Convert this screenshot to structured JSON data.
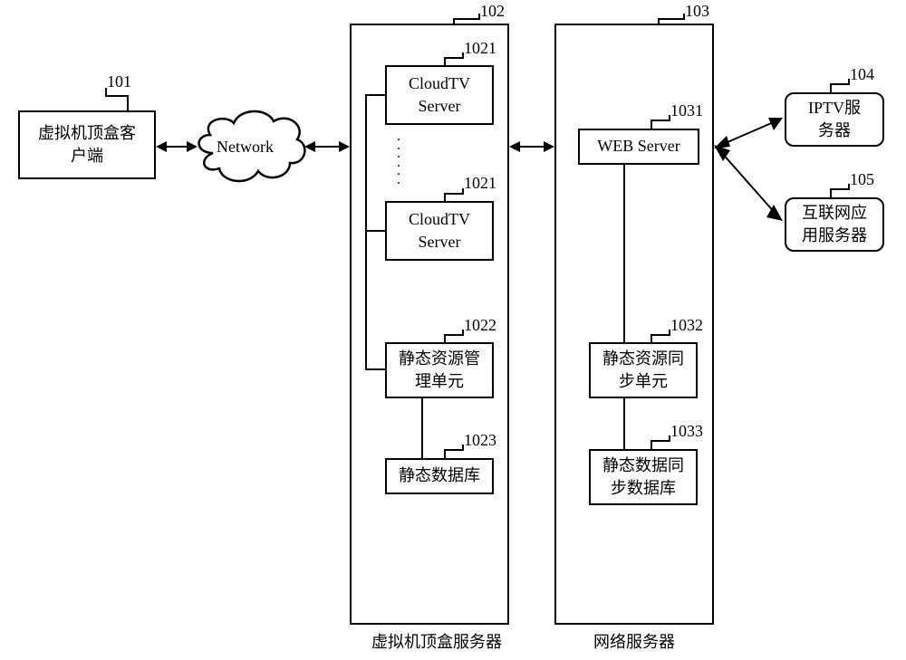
{
  "client": {
    "label": "虚拟机顶盒客\n户端",
    "id": "101"
  },
  "network": {
    "label": "Network"
  },
  "vstb_server": {
    "id": "102",
    "caption": "虚拟机顶盒服务器",
    "cloudtv": {
      "label": "CloudTV\nServer",
      "id": "1021"
    },
    "srm": {
      "label": "静态资源管\n理单元",
      "id": "1022"
    },
    "sdb": {
      "label": "静态数据库",
      "id": "1023"
    }
  },
  "net_server": {
    "id": "103",
    "caption": "网络服务器",
    "web": {
      "label": "WEB Server",
      "id": "1031"
    },
    "sync_unit": {
      "label": "静态资源同\n步单元",
      "id": "1032"
    },
    "sync_db": {
      "label": "静态数据同\n步数据库",
      "id": "1033"
    }
  },
  "iptv": {
    "label": "IPTV服\n务器",
    "id": "104"
  },
  "inet_app": {
    "label": "互联网应\n用服务器",
    "id": "105"
  }
}
